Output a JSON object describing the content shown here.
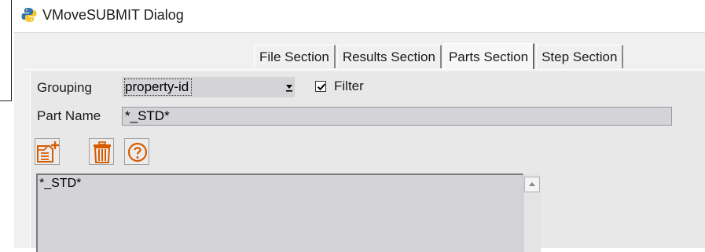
{
  "window": {
    "title": "VMoveSUBMIT Dialog",
    "icon": "python-logo-icon"
  },
  "tabs": [
    {
      "label": "File Section",
      "active": false
    },
    {
      "label": "Results Section",
      "active": false
    },
    {
      "label": "Parts Section",
      "active": true
    },
    {
      "label": "Step Section",
      "active": false
    }
  ],
  "grouping": {
    "label": "Grouping",
    "selected": "property-id"
  },
  "filter": {
    "label": "Filter",
    "checked": true
  },
  "part_name": {
    "label": "Part Name",
    "value": "*_STD*"
  },
  "toolbar": [
    {
      "icon": "add-document-icon"
    },
    {
      "icon": "trash-icon"
    },
    {
      "icon": "help-icon"
    }
  ],
  "parts_list": {
    "items": [
      "*_STD*"
    ]
  },
  "colors": {
    "field_bg": "#d3d3d8",
    "panel_bg": "#e8e8e8",
    "icon_orange": "#e06000"
  }
}
